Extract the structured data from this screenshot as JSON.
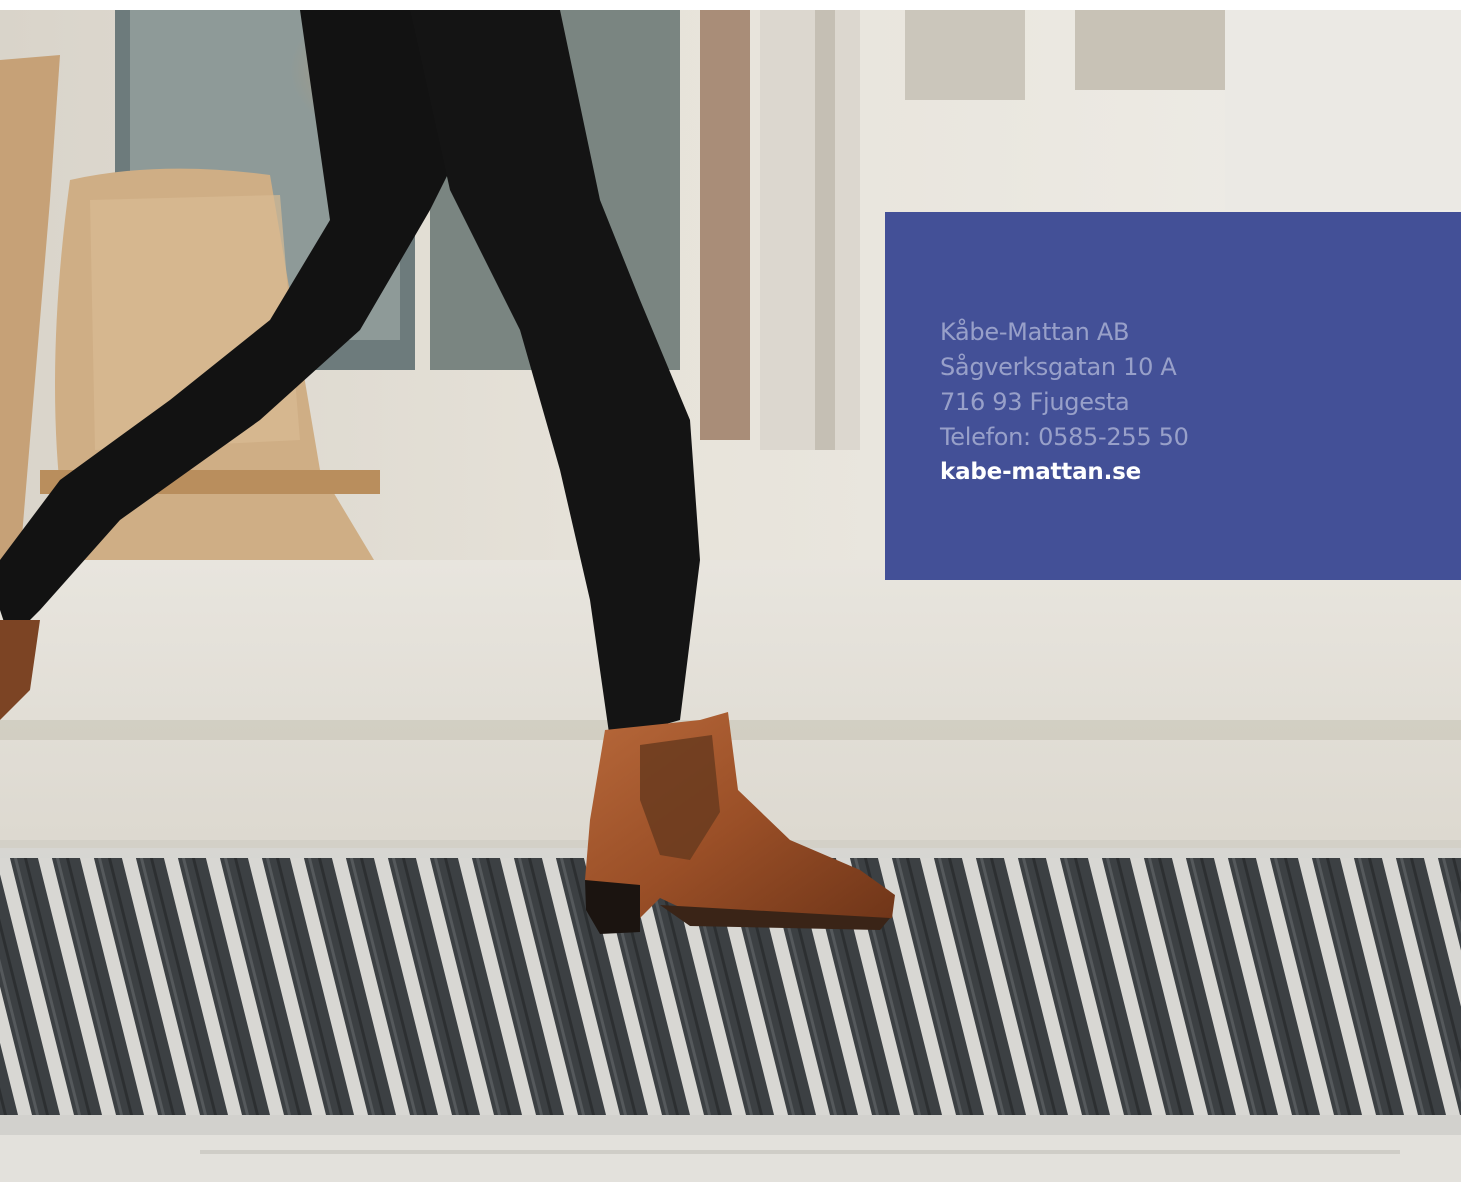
{
  "contact": {
    "company": "Kåbe-Mattan AB",
    "street": "Sågverksgatan 10 A",
    "postal": "716 93 Fjugesta",
    "phone": "Telefon: 0585-255 50",
    "website": "kabe-mattan.se"
  },
  "colors": {
    "card_background": "#435097",
    "card_text": "#cdd2e8",
    "website_text": "#ffffff"
  }
}
